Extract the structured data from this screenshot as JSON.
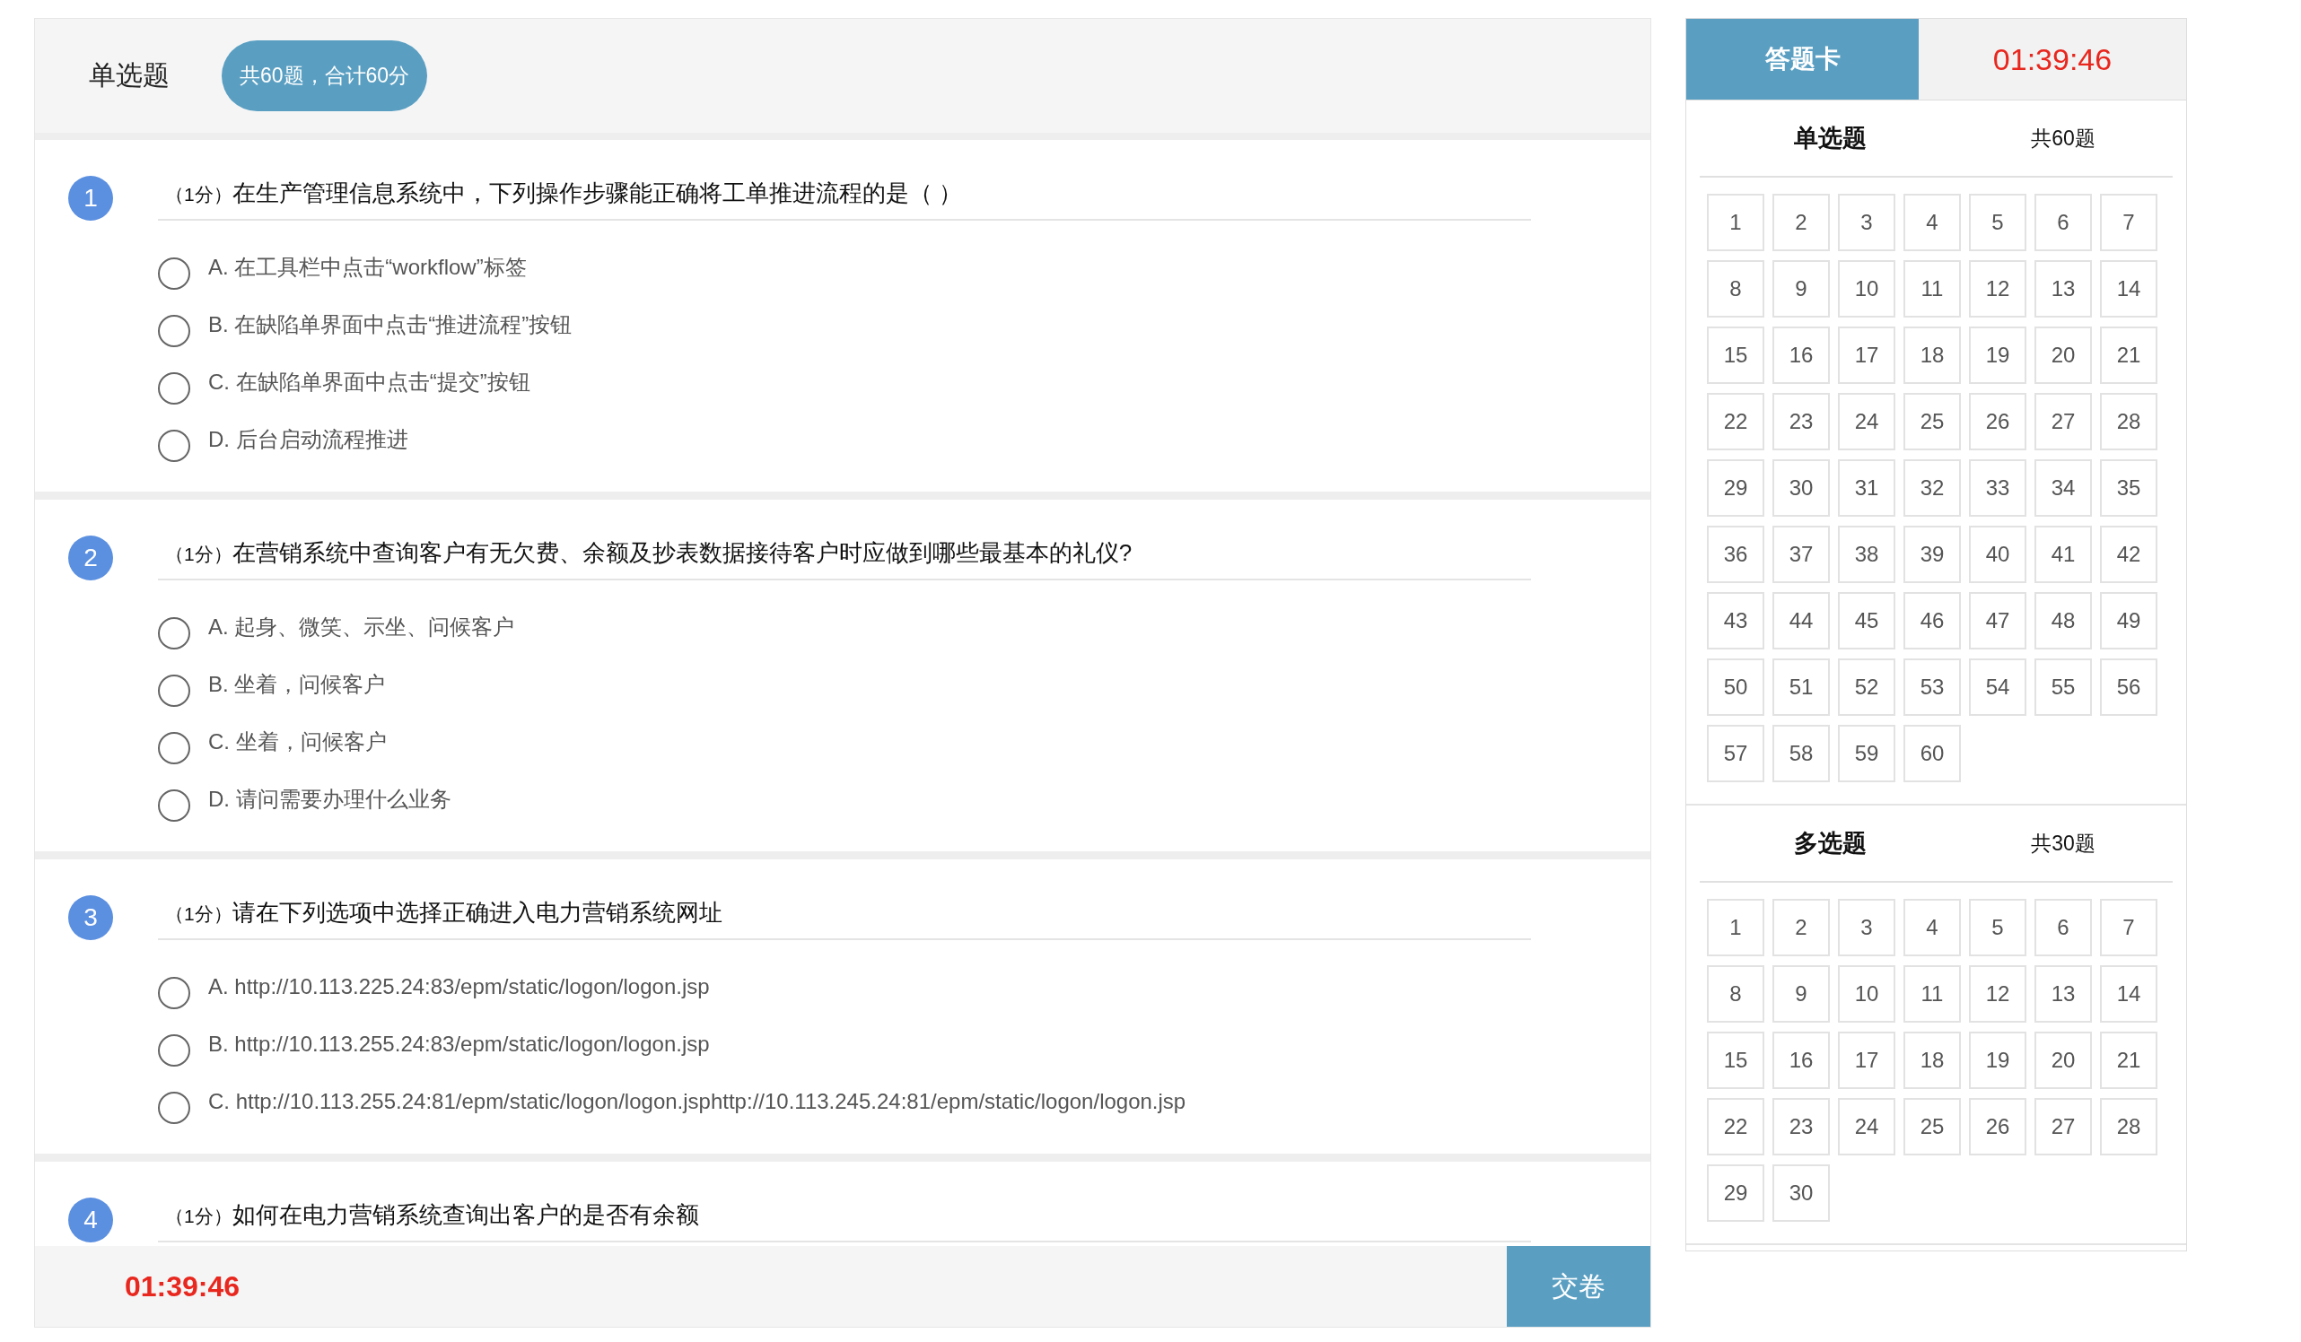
{
  "section": {
    "title": "单选题",
    "summary": "共60题，合计60分"
  },
  "questions": [
    {
      "number": "1",
      "score": "（1分）",
      "text": "在生产管理信息系统中，下列操作步骤能正确将工单推进流程的是（ ）",
      "options": [
        {
          "label": "A. 在工具栏中点击“workflow”标签",
          "selected": false
        },
        {
          "label": "B. 在缺陷单界面中点击“推进流程”按钮",
          "selected": false
        },
        {
          "label": "C. 在缺陷单界面中点击“提交”按钮",
          "selected": false
        },
        {
          "label": "D. 后台启动流程推进",
          "selected": false
        }
      ]
    },
    {
      "number": "2",
      "score": "（1分）",
      "text": "在营销系统中查询客户有无欠费、余额及抄表数据接待客户时应做到哪些最基本的礼仪?",
      "options": [
        {
          "label": "A. 起身、微笑、示坐、问候客户",
          "selected": false
        },
        {
          "label": "B. 坐着，问候客户",
          "selected": false
        },
        {
          "label": "C. 坐着，问候客户",
          "selected": false
        },
        {
          "label": "D. 请问需要办理什么业务",
          "selected": false
        }
      ]
    },
    {
      "number": "3",
      "score": "（1分）",
      "text": "请在下列选项中选择正确进入电力营销系统网址",
      "options": [
        {
          "label": "A. http://10.113.225.24:83/epm/static/logon/logon.jsp",
          "selected": false
        },
        {
          "label": "B. http://10.113.255.24:83/epm/static/logon/logon.jsp",
          "selected": false
        },
        {
          "label": "C. http://10.113.255.24:81/epm/static/logon/logon.jsphttp://10.113.245.24:81/epm/static/logon/logon.jsp",
          "selected": false
        }
      ]
    },
    {
      "number": "4",
      "score": "（1分）",
      "text": "如何在电力营销系统查询出客户的是否有余额"
    }
  ],
  "footer": {
    "timer": "01:39:46",
    "submit": "交卷"
  },
  "answer_card": {
    "tab": "答题卡",
    "timer": "01:39:46",
    "groups": [
      {
        "title": "单选题",
        "count": "共60题",
        "numbers": [
          "1",
          "2",
          "3",
          "4",
          "5",
          "6",
          "7",
          "8",
          "9",
          "10",
          "11",
          "12",
          "13",
          "14",
          "15",
          "16",
          "17",
          "18",
          "19",
          "20",
          "21",
          "22",
          "23",
          "24",
          "25",
          "26",
          "27",
          "28",
          "29",
          "30",
          "31",
          "32",
          "33",
          "34",
          "35",
          "36",
          "37",
          "38",
          "39",
          "40",
          "41",
          "42",
          "43",
          "44",
          "45",
          "46",
          "47",
          "48",
          "49",
          "50",
          "51",
          "52",
          "53",
          "54",
          "55",
          "56",
          "57",
          "58",
          "59",
          "60"
        ]
      },
      {
        "title": "多选题",
        "count": "共30题",
        "numbers": [
          "1",
          "2",
          "3",
          "4",
          "5",
          "6",
          "7",
          "8",
          "9",
          "10",
          "11",
          "12",
          "13",
          "14",
          "15",
          "16",
          "17",
          "18",
          "19",
          "20",
          "21",
          "22",
          "23",
          "24",
          "25",
          "26",
          "27",
          "28",
          "29",
          "30"
        ]
      }
    ]
  }
}
